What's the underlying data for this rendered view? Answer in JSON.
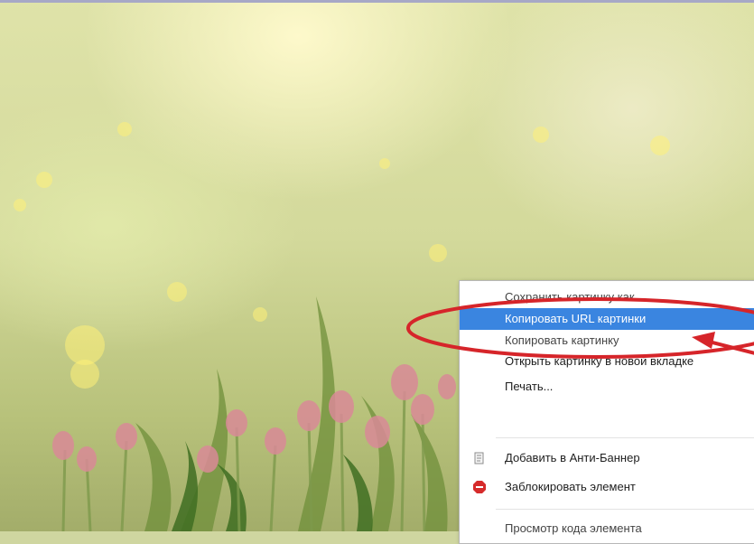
{
  "context_menu": {
    "items": [
      {
        "label": "Сохранить картинку как..."
      },
      {
        "label": "Копировать URL картинки"
      },
      {
        "label": "Копировать картинку"
      },
      {
        "label": "Открыть картинку в новой вкладке"
      },
      {
        "label": "Печать..."
      },
      {
        "label": "Добавить в Анти-Баннер",
        "icon": "anti-banner-icon"
      },
      {
        "label": "Заблокировать элемент",
        "icon": "adblock-stop-icon"
      },
      {
        "label": "Просмотр кода элемента"
      }
    ],
    "selected_index": 1
  },
  "colors": {
    "selection": "#3a85e0",
    "annotation": "#d6252a"
  }
}
